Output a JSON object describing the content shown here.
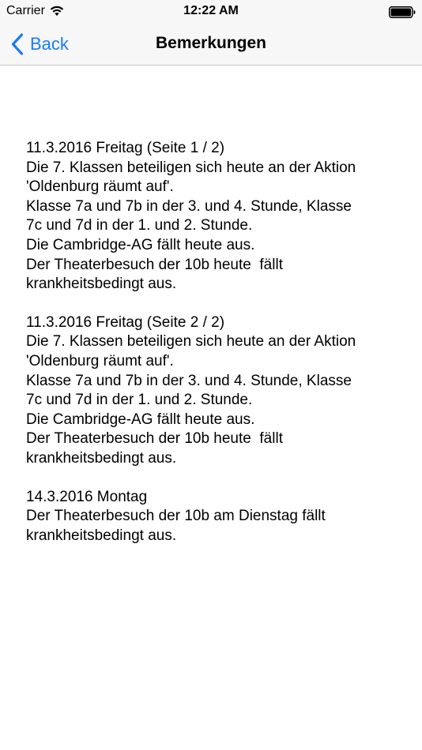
{
  "status_bar": {
    "carrier": "Carrier",
    "time": "12:22 AM"
  },
  "nav": {
    "back_label": "Back",
    "title": "Bemerkungen"
  },
  "colors": {
    "accent": "#1a7cf5",
    "bar_background": "#f7f7f7"
  },
  "entries": [
    {
      "lines": [
        "11.3.2016 Freitag (Seite 1 / 2)",
        "Die 7. Klassen beteiligen sich heute an der Aktion",
        "'Oldenburg räumt auf'.",
        "Klasse 7a und 7b in der 3. und 4. Stunde, Klasse",
        "7c und 7d in der 1. und 2. Stunde.",
        "Die Cambridge-AG fällt heute aus.",
        "Der Theaterbesuch der 10b heute  fällt",
        "krankheitsbedingt aus."
      ]
    },
    {
      "lines": [
        "11.3.2016 Freitag (Seite 2 / 2)",
        "Die 7. Klassen beteiligen sich heute an der Aktion",
        "'Oldenburg räumt auf'.",
        "Klasse 7a und 7b in der 3. und 4. Stunde, Klasse",
        "7c und 7d in der 1. und 2. Stunde.",
        "Die Cambridge-AG fällt heute aus.",
        "Der Theaterbesuch der 10b heute  fällt",
        "krankheitsbedingt aus."
      ]
    },
    {
      "lines": [
        "14.3.2016 Montag",
        "Der Theaterbesuch der 10b am Dienstag fällt",
        "krankheitsbedingt aus."
      ]
    }
  ]
}
